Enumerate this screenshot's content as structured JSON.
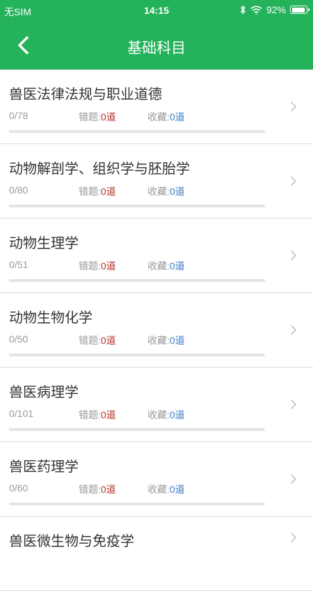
{
  "status_bar": {
    "carrier": "无SIM",
    "time": "14:15",
    "battery_text": "92%",
    "battery_level": 0.92,
    "icons": [
      "bluetooth-icon",
      "wifi-icon",
      "battery-icon"
    ]
  },
  "header": {
    "title": "基础科目",
    "back_icon": "chevron-left-icon",
    "background_color": "#24b25a"
  },
  "colors": {
    "accent": "#24b25a",
    "wrong_value": "#b2352d",
    "fav_value": "#3b7bc8"
  },
  "subjects": [
    {
      "name": "兽医法律法规与职业道德",
      "progress": "0/78",
      "progress_value": 0,
      "wrong_label": "错题:",
      "wrong_value": "0道",
      "fav_label": "收藏:",
      "fav_value": "0道"
    },
    {
      "name": "动物解剖学、组织学与胚胎学",
      "progress": "0/80",
      "progress_value": 0,
      "wrong_label": "错题:",
      "wrong_value": "0道",
      "fav_label": "收藏:",
      "fav_value": "0道"
    },
    {
      "name": "动物生理学",
      "progress": "0/51",
      "progress_value": 0,
      "wrong_label": "错题:",
      "wrong_value": "0道",
      "fav_label": "收藏:",
      "fav_value": "0道"
    },
    {
      "name": "动物生物化学",
      "progress": "0/50",
      "progress_value": 0,
      "wrong_label": "错题:",
      "wrong_value": "0道",
      "fav_label": "收藏:",
      "fav_value": "0道"
    },
    {
      "name": "兽医病理学",
      "progress": "0/101",
      "progress_value": 0,
      "wrong_label": "错题:",
      "wrong_value": "0道",
      "fav_label": "收藏:",
      "fav_value": "0道"
    },
    {
      "name": "兽医药理学",
      "progress": "0/60",
      "progress_value": 0,
      "wrong_label": "错题:",
      "wrong_value": "0道",
      "fav_label": "收藏:",
      "fav_value": "0道"
    },
    {
      "name": "兽医微生物与免疫学",
      "progress": "",
      "progress_value": 0,
      "wrong_label": "",
      "wrong_value": "",
      "fav_label": "",
      "fav_value": ""
    }
  ]
}
